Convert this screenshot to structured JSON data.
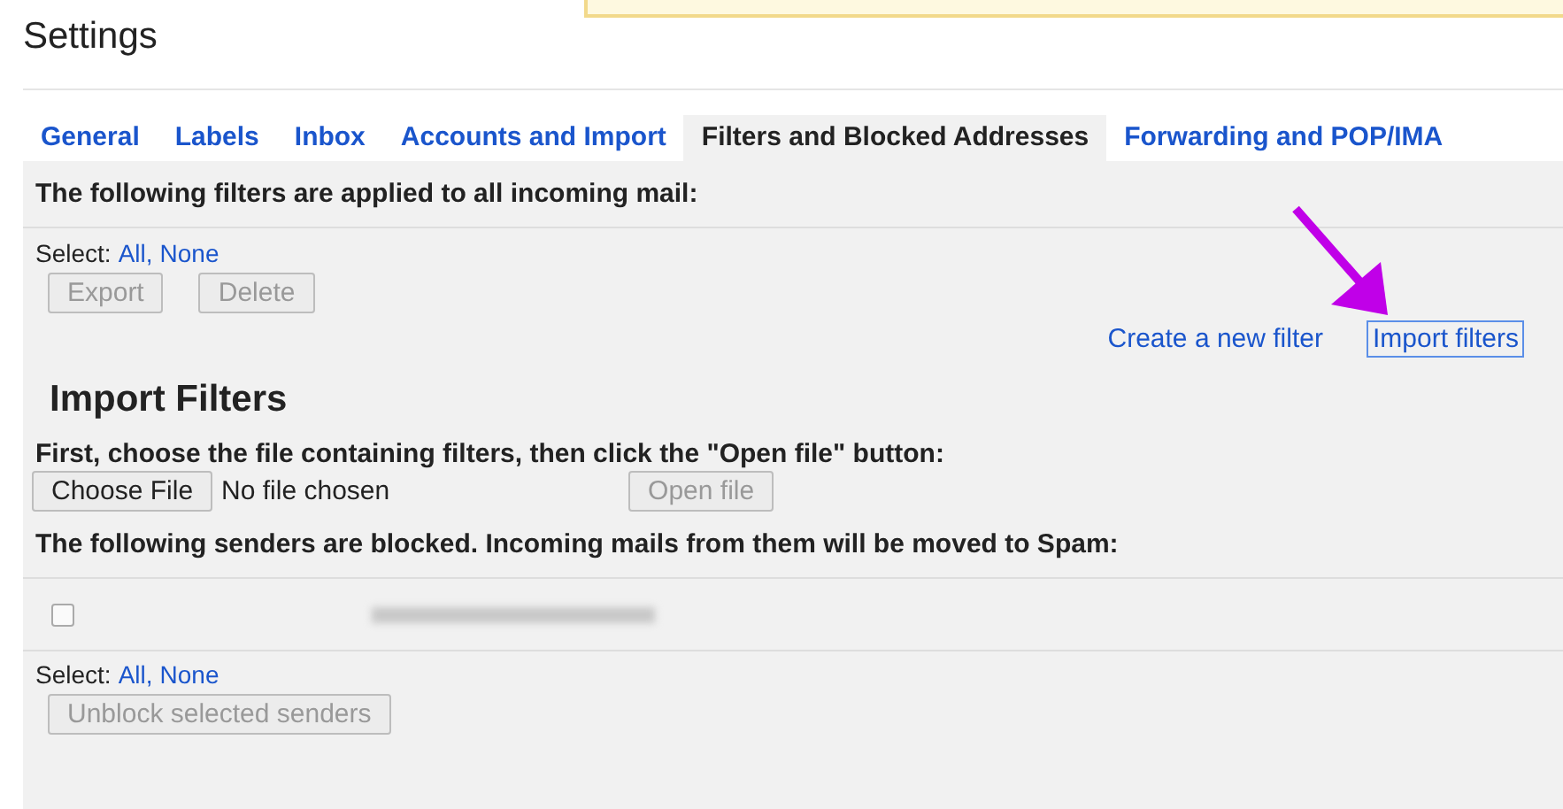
{
  "page_title": "Settings",
  "tabs": [
    {
      "label": "General",
      "selected": false
    },
    {
      "label": "Labels",
      "selected": false
    },
    {
      "label": "Inbox",
      "selected": false
    },
    {
      "label": "Accounts and Import",
      "selected": false
    },
    {
      "label": "Filters and Blocked Addresses",
      "selected": true
    },
    {
      "label": "Forwarding and POP/IMA",
      "selected": false
    }
  ],
  "filters_section": {
    "heading": "The following filters are applied to all incoming mail:",
    "select_label": "Select:",
    "select_links": [
      "All,",
      "None"
    ],
    "buttons": [
      {
        "label": "Export",
        "disabled": true
      },
      {
        "label": "Delete",
        "disabled": true
      }
    ],
    "links": [
      {
        "label": "Create a new filter",
        "focused": false
      },
      {
        "label": "Import filters",
        "focused": true
      }
    ]
  },
  "import_section": {
    "heading": "Import Filters",
    "instruction": "First, choose the file containing filters, then click the \"Open file\" button:",
    "choose_button": {
      "label": "Choose File",
      "disabled": false
    },
    "file_status": "No file chosen",
    "open_button": {
      "label": "Open file",
      "disabled": true
    }
  },
  "blocked_section": {
    "heading": "The following senders are blocked. Incoming mails from them will be moved to Spam:",
    "senders": [
      {
        "checked": false
      }
    ],
    "select_label": "Select:",
    "select_links": [
      "All,",
      "None"
    ],
    "unblock_button": {
      "label": "Unblock selected senders",
      "disabled": true
    }
  }
}
